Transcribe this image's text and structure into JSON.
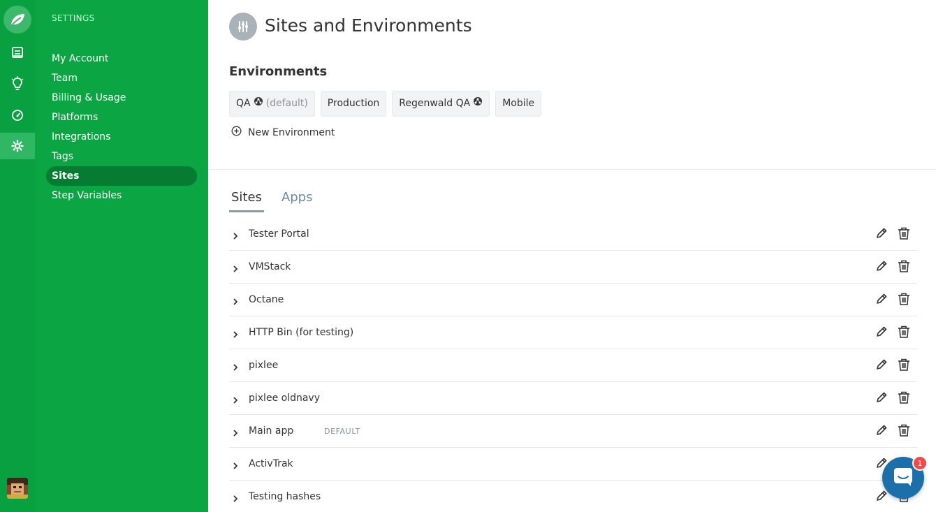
{
  "sidebar": {
    "heading": "SETTINGS",
    "items": [
      {
        "label": "My Account"
      },
      {
        "label": "Team"
      },
      {
        "label": "Billing & Usage"
      },
      {
        "label": "Platforms"
      },
      {
        "label": "Integrations"
      },
      {
        "label": "Tags"
      },
      {
        "label": "Sites",
        "active": true
      },
      {
        "label": "Step Variables"
      }
    ]
  },
  "page": {
    "title": "Sites and Environments"
  },
  "environments": {
    "heading": "Environments",
    "items": [
      {
        "label": "QA",
        "suffix": "(default)",
        "icon": "network-icon"
      },
      {
        "label": "Production"
      },
      {
        "label": "Regenwald QA",
        "icon": "network-icon"
      },
      {
        "label": "Mobile"
      }
    ],
    "new_label": "New Environment"
  },
  "tabs": [
    {
      "label": "Sites",
      "active": true
    },
    {
      "label": "Apps"
    }
  ],
  "sites": [
    {
      "name": "Tester Portal"
    },
    {
      "name": "VMStack"
    },
    {
      "name": "Octane"
    },
    {
      "name": "HTTP Bin (for testing)"
    },
    {
      "name": "pixlee"
    },
    {
      "name": "pixlee oldnavy"
    },
    {
      "name": "Main app",
      "badge": "DEFAULT"
    },
    {
      "name": "ActivTrak"
    },
    {
      "name": "Testing hashes"
    }
  ],
  "chat": {
    "unread": "1"
  },
  "colors": {
    "rail": "#08a040",
    "sidebar": "#0ca544",
    "sidebar_active": "#057c32",
    "chat": "#1c6fa8",
    "badge": "#f04a4a"
  }
}
